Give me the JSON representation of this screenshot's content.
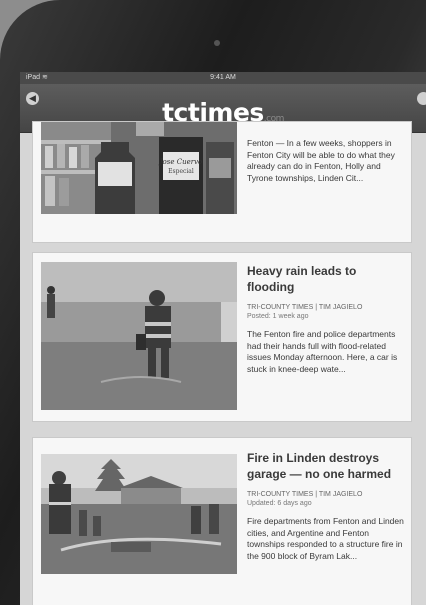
{
  "status_bar": {
    "carrier": "iPad ≋",
    "time": "9:41 AM"
  },
  "nav": {
    "logo": "tctimes",
    "logo_suffix": ".com"
  },
  "articles": [
    {
      "headline": "",
      "byline": "",
      "posted": "",
      "summary": "Fenton — In a few weeks, shoppers in Fenton City will be able to do what they already can do in Fenton, Holly and Tyrone townships, Linden Cit..."
    },
    {
      "headline": "Heavy rain leads to flooding",
      "byline": "TRI-COUNTY TIMES | TIM JAGIELO",
      "posted": "Posted: 1 week ago",
      "summary": "The Fenton fire and police departments had their hands full with flood-related issues Monday afternoon. Here, a car is stuck in knee-deep wate..."
    },
    {
      "headline": "Fire in Linden destroys garage — no one harmed",
      "byline": "TRI-COUNTY TIMES | TIM JAGIELO",
      "posted": "Updated: 6 days ago",
      "summary": "Fire departments from Fenton and Linden cities, and Argentine and Fenton townships responded to a structure fire in the 900 block of Byram Lak..."
    }
  ],
  "images": {
    "shelf_label_1": "Jose Cuervo",
    "shelf_label_2": "Especial"
  }
}
